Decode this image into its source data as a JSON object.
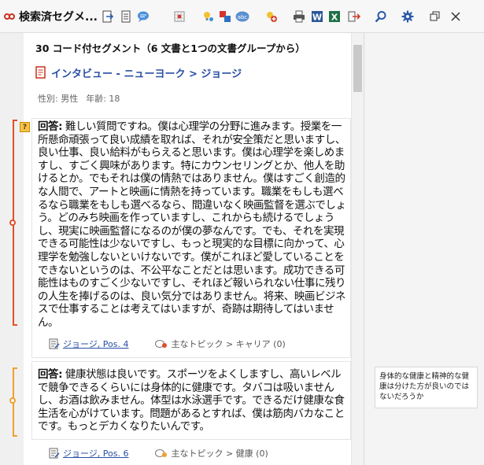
{
  "toolbar": {
    "title": "検索済セグメ...",
    "buttons": [
      {
        "name": "export-button"
      },
      {
        "name": "document-view-button"
      },
      {
        "name": "comment-button"
      },
      {
        "name": "code-matrix-button"
      },
      {
        "name": "code-lightbulb-button"
      },
      {
        "name": "color-code-button"
      },
      {
        "name": "abc-code-button"
      },
      {
        "name": "add-code-button"
      },
      {
        "name": "print-button"
      },
      {
        "name": "word-export-button"
      },
      {
        "name": "excel-export-button"
      },
      {
        "name": "exit-button"
      },
      {
        "name": "search-button"
      },
      {
        "name": "settings-button"
      },
      {
        "name": "restore-window-button"
      },
      {
        "name": "close-button"
      }
    ]
  },
  "header": {
    "segment_count": "30 コード付セグメント（6 文書と1つの文書グループから）",
    "document_link": "インタビュー - ニューヨーク > ジョージ",
    "attributes": [
      "性別: 男性",
      "年齢: 18"
    ]
  },
  "segments": [
    {
      "label": "回答:",
      "text": "難しい質問ですね。僕は心理学の分野に進みます。授業を一所懸命頑張って良い成績を取れば、それが安全策だと思いますし、良い仕事、良い給料がもらえると思います。僕は心理学を楽しめますし、すごく興味があります。特にカウンセリングとか、他人を助けるとか。でもそれは僕の情熱ではありません。僕はすごく創造的な人間で、アートと映画に情熱を持っています。職業をもしも選べるなら職業をもしも選べるなら、間違いなく映画監督を選ぶでしょう。どのみち映画を作っていますし、これからも続けるでしょうし、現実に映画監督になるのが僕の夢なんです。でも、それを実現できる可能性は少ないですし、もっと現実的な目標に向かって、心理学を勉強しないといけないです。僕がこれほど愛していることをできないというのは、不公平なことだとは思います。成功できる可能性はものすごく少ないですし、それほど報いられない仕事に残りの人生を捧げるのは、良い気分ではありません。将来、映画ビジネスで仕事することは考えてはいますが、奇跡は期待してはいません。",
      "source": "ジョージ, Pos. 4",
      "code": "主なトピック > キャリア (0)",
      "color": "#e0502a"
    },
    {
      "label": "回答:",
      "text": "健康状態は良いです。スポーツをよくしますし、高いレベルで競争できるくらいには身体的に健康です。タバコは吸いませんし、お酒は飲みません。体型は水泳選手です。できるだけ健康な食生活を心がけています。問題があるとすれば、僕は筋肉バカなことです。もっとデカくなりたいんです。",
      "source": "ジョージ, Pos. 6",
      "code": "主なトピック > 健康 (0)",
      "color": "#f0a030"
    }
  ],
  "memo": {
    "text": "身体的な健康と精神的な健康は分けた方が良いのではないだろうか"
  }
}
